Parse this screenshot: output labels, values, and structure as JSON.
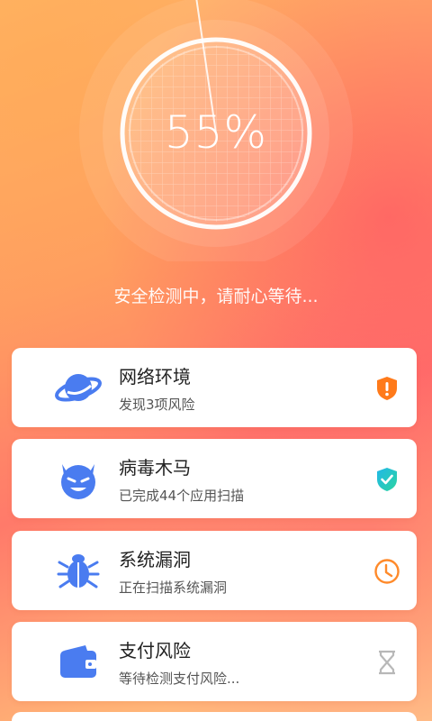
{
  "scan": {
    "percent_text": "55%",
    "progress": 0.55,
    "status": "安全检测中，请耐心等待..."
  },
  "items": [
    {
      "title": "网络环境",
      "subtitle": "发现3项风险",
      "icon": "planet-icon",
      "status_icon": "warning-shield-icon",
      "state": "risk"
    },
    {
      "title": "病毒木马",
      "subtitle": "已完成44个应用扫描",
      "icon": "devil-icon",
      "status_icon": "check-shield-icon",
      "state": "done"
    },
    {
      "title": "系统漏洞",
      "subtitle": "正在扫描系统漏洞",
      "icon": "bug-icon",
      "status_icon": "clock-icon",
      "state": "scanning"
    },
    {
      "title": "支付风险",
      "subtitle": "等待检测支付风险...",
      "icon": "wallet-icon",
      "status_icon": "hourglass-icon",
      "state": "waiting"
    }
  ],
  "colors": {
    "accent_blue": "#4a7cf0",
    "warning_orange": "#ff7a1a",
    "success_teal": "#2cc7a6",
    "clock_orange": "#ff8a2a",
    "waiting_gray": "#b8b8b8"
  }
}
